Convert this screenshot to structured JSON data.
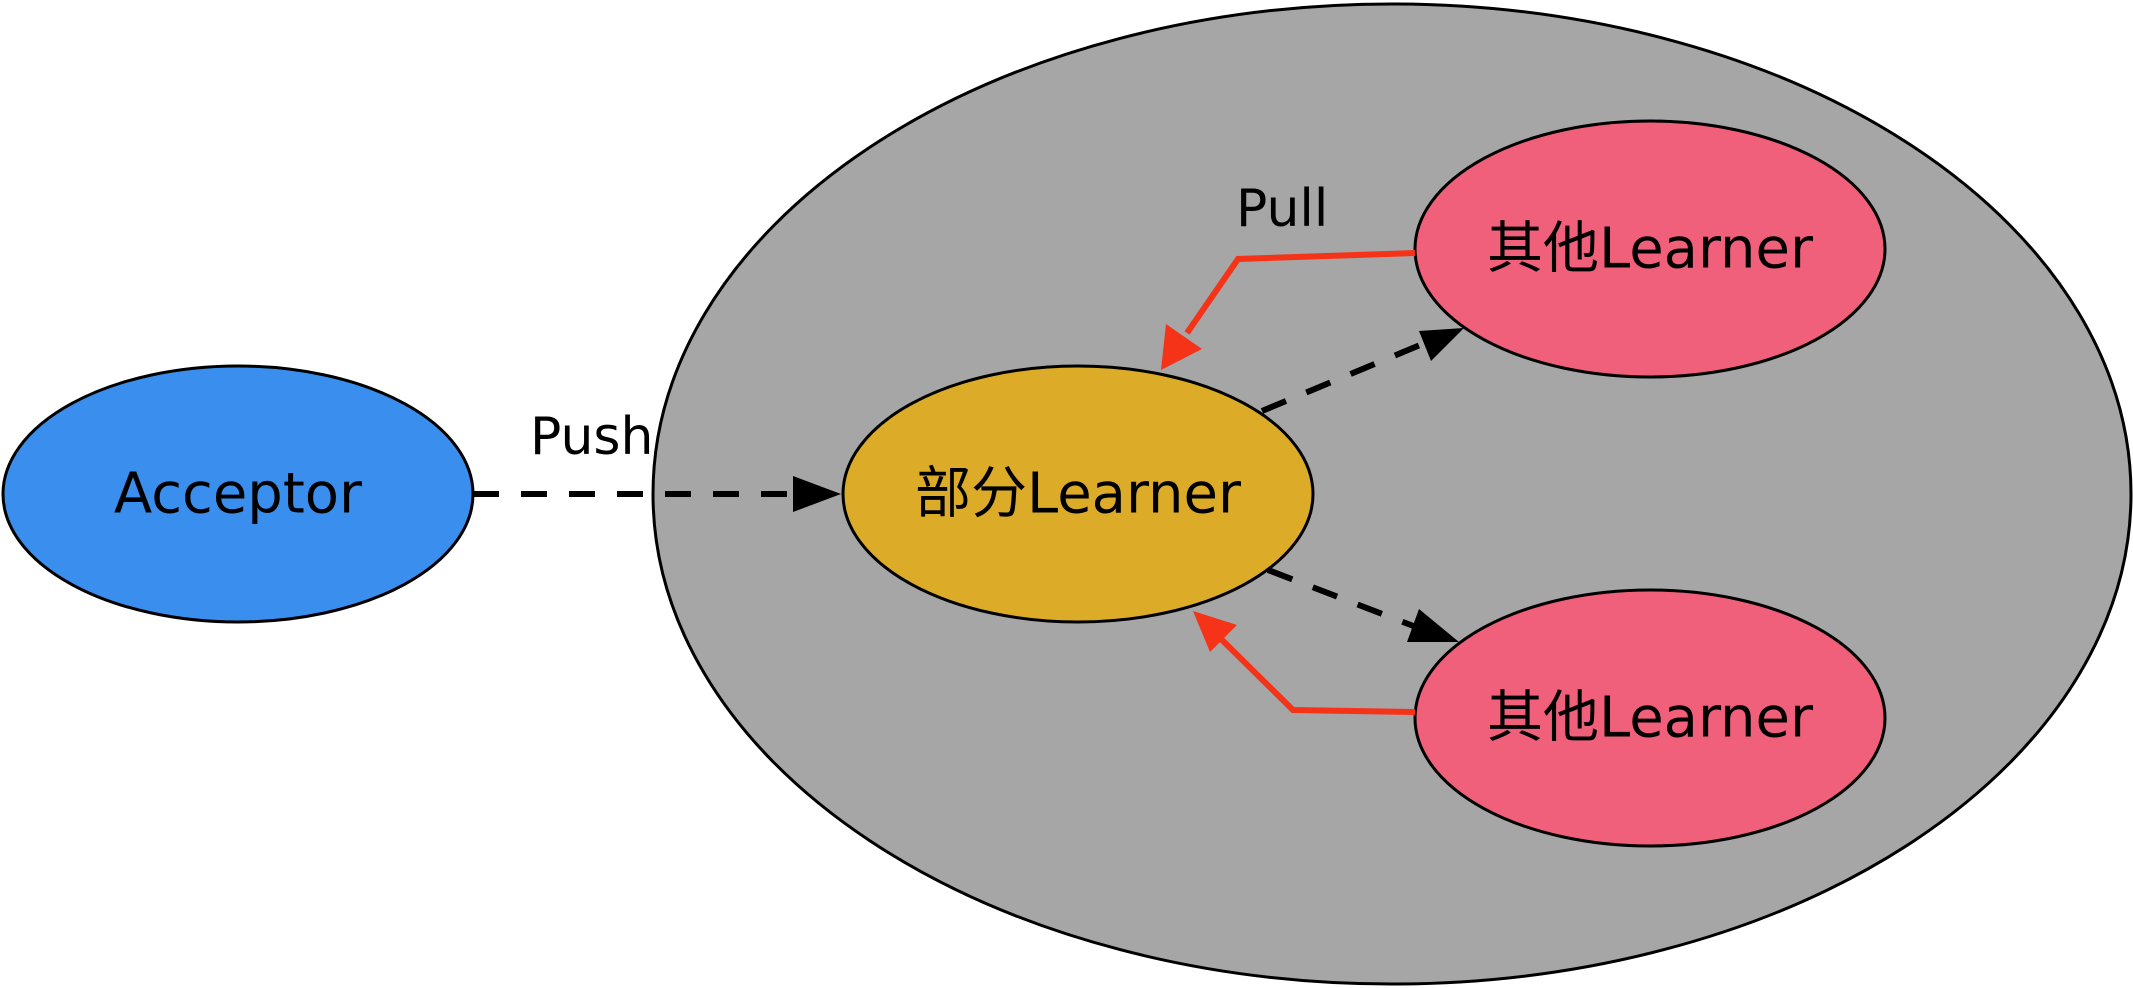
{
  "nodes": {
    "acceptor": {
      "label": "Acceptor",
      "color": "#3a8fee"
    },
    "partial_learner": {
      "label": "部分Learner",
      "color": "#dcac29"
    },
    "other_learner_top": {
      "label": "其他Learner",
      "color": "#f0607a"
    },
    "other_learner_bottom": {
      "label": "其他Learner",
      "color": "#f0607a"
    }
  },
  "cluster": {
    "color": "#a6a6a6"
  },
  "edges": {
    "push": {
      "label": "Push",
      "style": "dashed",
      "color": "#000000"
    },
    "pull": {
      "label": "Pull",
      "style": "solid",
      "color": "#f53318"
    }
  }
}
